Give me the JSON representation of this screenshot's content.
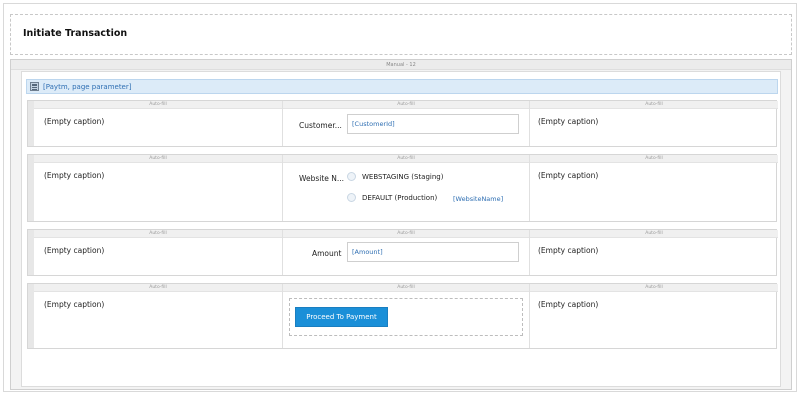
{
  "page": {
    "title": "Initiate Transaction"
  },
  "outer": {
    "label": "Manual - 12"
  },
  "parameters": {
    "label": "[Paytm, page parameter]",
    "icon": "table-icon"
  },
  "cell_header": "Auto-fill",
  "empty_caption": "(Empty caption)",
  "rows": [
    {
      "label": "Customer...",
      "value": "[CustomerId]"
    },
    {
      "label": "Website N...",
      "options": [
        "WEBSTAGING (Staging)",
        "DEFAULT (Production)"
      ],
      "bind": "[WebsiteName]"
    },
    {
      "label": "Amount",
      "value": "[Amount]"
    },
    {
      "button": "Proceed To Payment"
    }
  ],
  "colors": {
    "accent": "#1a8fd8",
    "link": "#2f6fb3",
    "param_bg": "#dcebf8"
  }
}
